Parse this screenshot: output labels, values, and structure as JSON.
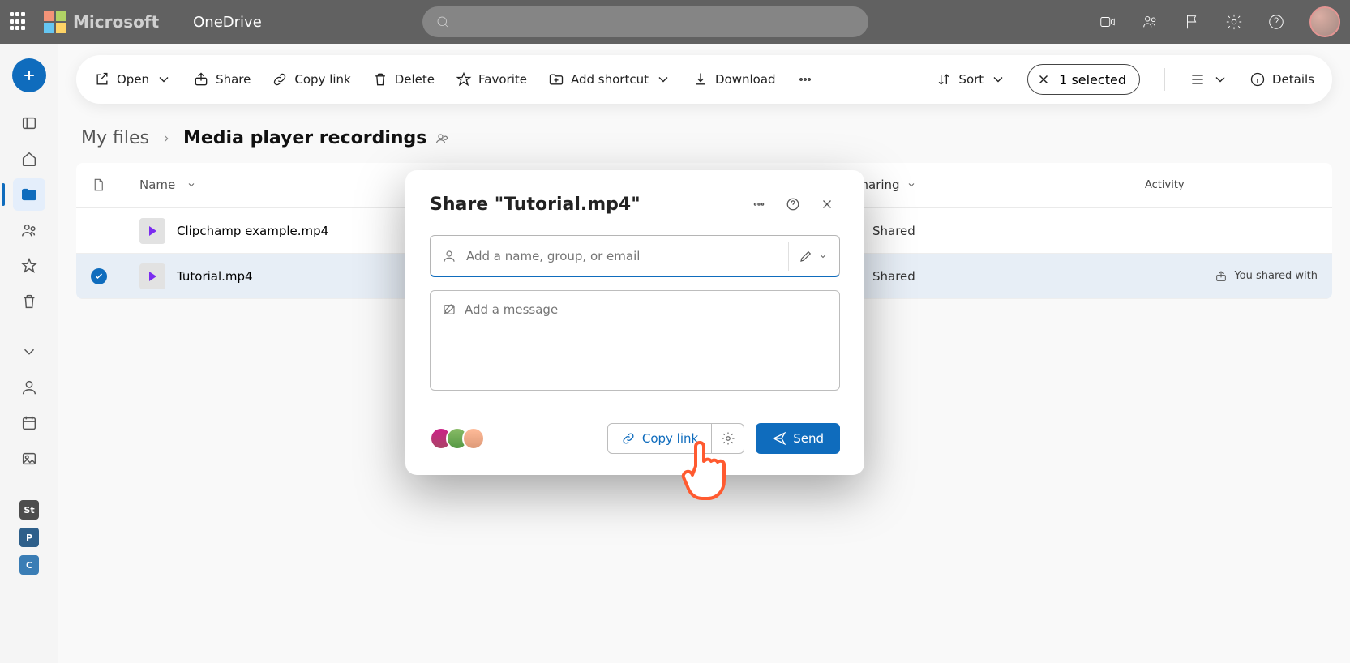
{
  "header": {
    "brand": "Microsoft",
    "app": "OneDrive"
  },
  "toolbar": {
    "open": "Open",
    "share": "Share",
    "copy_link": "Copy link",
    "delete": "Delete",
    "favorite": "Favorite",
    "add_shortcut": "Add shortcut",
    "download": "Download",
    "sort": "Sort",
    "selected": "1 selected",
    "details": "Details"
  },
  "breadcrumb": {
    "root": "My files",
    "current": "Media player recordings"
  },
  "columns": {
    "name": "Name",
    "sharing": "Sharing",
    "activity": "Activity"
  },
  "rows": [
    {
      "name": "Clipchamp example.mp4",
      "sharing": "Shared",
      "activity": "",
      "selected": false
    },
    {
      "name": "Tutorial.mp4",
      "sharing": "Shared",
      "activity": "You shared with",
      "selected": true
    }
  ],
  "dialog": {
    "title": "Share \"Tutorial.mp4\"",
    "recipient_placeholder": "Add a name, group, or email",
    "message_placeholder": "Add a message",
    "copy_link": "Copy link",
    "send": "Send"
  }
}
